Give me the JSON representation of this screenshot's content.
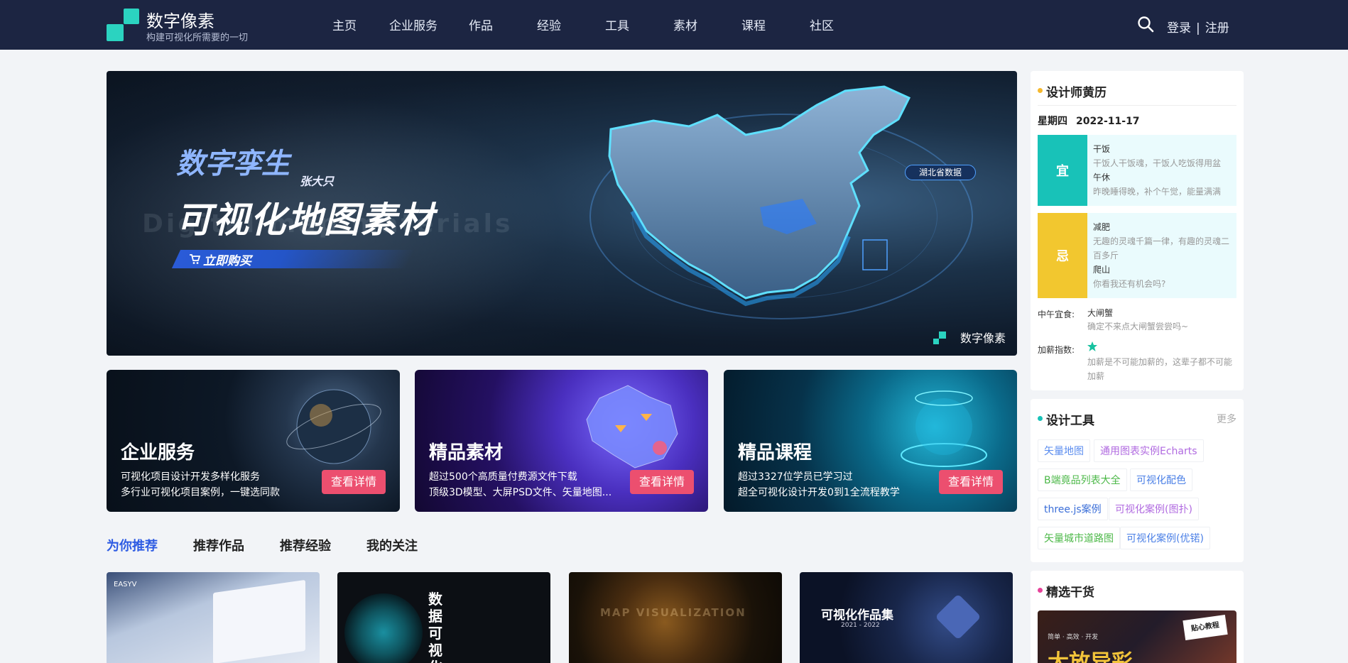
{
  "header": {
    "brand_name": "数字像素",
    "brand_slogan": "构建可视化所需要的一切",
    "nav": [
      "主页",
      "企业服务",
      "作品",
      "经验",
      "工具",
      "素材",
      "课程",
      "社区"
    ],
    "login": "登录",
    "separator": "|",
    "register": "注册"
  },
  "banner": {
    "subtitle": "数字孪生",
    "author": "张大只",
    "title": "可视化地图素材",
    "background_text": "Digital map materials",
    "buy_label": "立即购买",
    "map_label": "湖北省数据",
    "watermark": "数字像素"
  },
  "features": [
    {
      "title": "企业服务",
      "line1": "可视化项目设计开发多样化服务",
      "line2": "多行业可视化项目案例，一键选同款",
      "button": "查看详情"
    },
    {
      "title": "精品素材",
      "line1": "超过500个高质量付费源文件下载",
      "line2": "顶级3D模型、大屏PSD文件、矢量地图...",
      "button": "查看详情"
    },
    {
      "title": "精品课程",
      "line1": "超过3327位学员已学习过",
      "line2": "超全可视化设计开发0到1全流程教学",
      "button": "查看详情"
    }
  ],
  "tabs": [
    "为你推荐",
    "推荐作品",
    "推荐经验",
    "我的关注"
  ],
  "works": [
    {
      "label": "EASYV"
    },
    {
      "label": "数据可视化"
    },
    {
      "label": "MAP VISUALIZATION"
    },
    {
      "label": "可视化作品集",
      "sub": "2021 - 2022"
    }
  ],
  "almanac": {
    "title": "设计师黄历",
    "weekday": "星期四",
    "date": "2022-11-17",
    "good_tag": "宜",
    "good": [
      {
        "name": "干饭",
        "desc": "干饭人干饭魂，干饭人吃饭得用盆"
      },
      {
        "name": "午休",
        "desc": "昨晚睡得晚，补个午觉，能量满满"
      }
    ],
    "bad_tag": "忌",
    "bad": [
      {
        "name": "减肥",
        "desc": "无趣的灵魂千篇一律，有趣的灵魂二百多斤"
      },
      {
        "name": "爬山",
        "desc": "你看我还有机会吗?"
      }
    ],
    "lunch_label": "中午宜食:",
    "lunch_value": "大闸蟹",
    "lunch_desc": "确定不来点大闸蟹尝尝吗~",
    "raise_label": "加薪指数:",
    "raise_desc": "加薪是不可能加薪的，这辈子都不可能加薪",
    "raise_stars": 1
  },
  "tools": {
    "title": "设计工具",
    "more": "更多",
    "items": [
      {
        "label": "矢量地图",
        "color": "#5b8def"
      },
      {
        "label": "通用图表实例Echarts",
        "color": "#b06ae0"
      },
      {
        "label": "B端竟品列表大全",
        "color": "#4cb848"
      },
      {
        "label": "可视化配色",
        "color": "#4a7fe6"
      },
      {
        "label": "three.js案例",
        "color": "#3a6ed8"
      },
      {
        "label": "可视化案例(图扑)",
        "color": "#b06ae0"
      },
      {
        "label": "矢量城市道路图",
        "color": "#4cb848"
      },
      {
        "label": "可视化案例(优锘)",
        "color": "#4a7fe6"
      }
    ]
  },
  "dry_goods": {
    "title": "精选干货",
    "badge": "贴心教程",
    "thumb_top": "简单 · 高效 · 开发",
    "thumb_text": "大放异彩"
  },
  "colors": {
    "header_bg": "#1c2542",
    "brand_accent": "#2bd3c0",
    "button": "#ec4f6f",
    "active_tab": "#2d5be3",
    "good_tag": "#18c2b8",
    "bad_tag": "#f2c72f",
    "almanac_dot": "#f5b82e",
    "tools_dot": "#18c2b8",
    "dry_dot": "#e6439a"
  }
}
